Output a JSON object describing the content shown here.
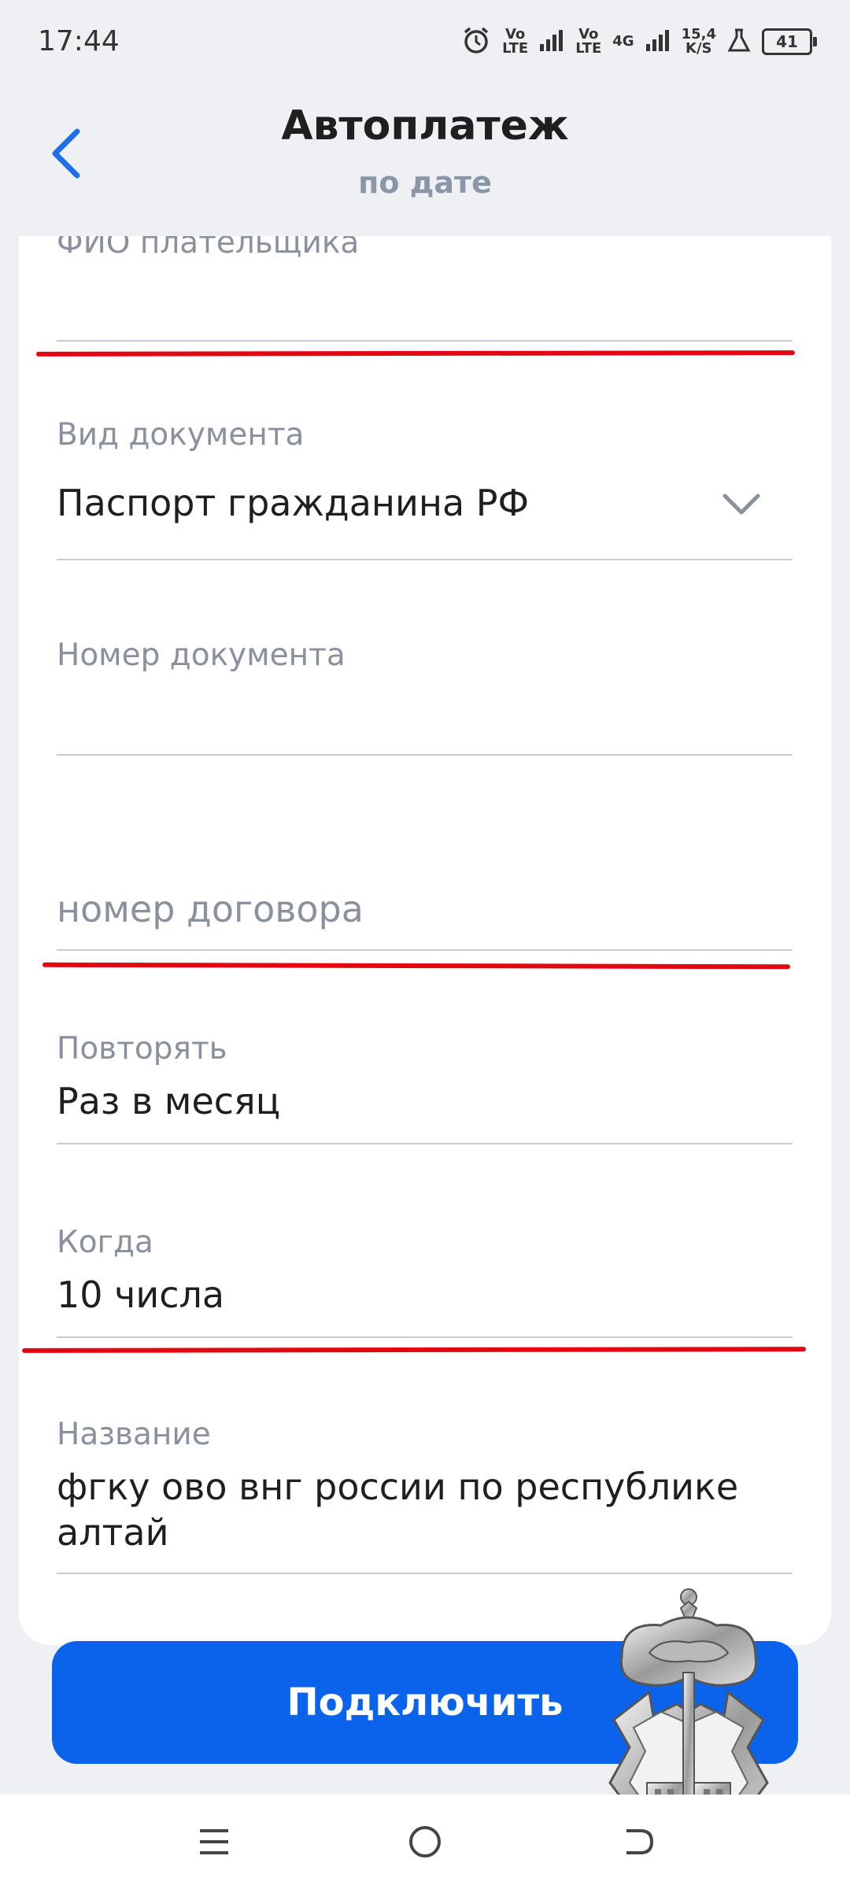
{
  "status_bar": {
    "time": "17:44",
    "net_speed_top": "15,4",
    "net_speed_bottom": "K/S",
    "battery": "41",
    "sim1_top": "Vo",
    "sim1_bottom": "LTE",
    "sim2_top": "Vo",
    "sim2_bottom": "LTE",
    "net_type": "4G"
  },
  "header": {
    "title": "Автоплатеж",
    "subtitle": "по дате",
    "back_icon": "chevron-left-icon"
  },
  "form": {
    "payer_name": {
      "label": "ФИО плательщика",
      "value": ""
    },
    "doc_type": {
      "label": "Вид документа",
      "value": "Паспорт гражданина РФ"
    },
    "doc_number": {
      "label": "Номер документа",
      "value": ""
    },
    "contract": {
      "placeholder": "номер договора"
    },
    "repeat": {
      "label": "Повторять",
      "value": "Раз в месяц"
    },
    "when": {
      "label": "Когда",
      "value": "10 числа"
    },
    "name": {
      "label": "Название",
      "value": "фгку ово внг россии по республике алтай"
    }
  },
  "actions": {
    "connect_label": "Подключить"
  },
  "colors": {
    "accent": "#0a63ea",
    "annotation_red": "#e30613",
    "label_gray": "#8a919c",
    "background": "#eef0f4"
  }
}
